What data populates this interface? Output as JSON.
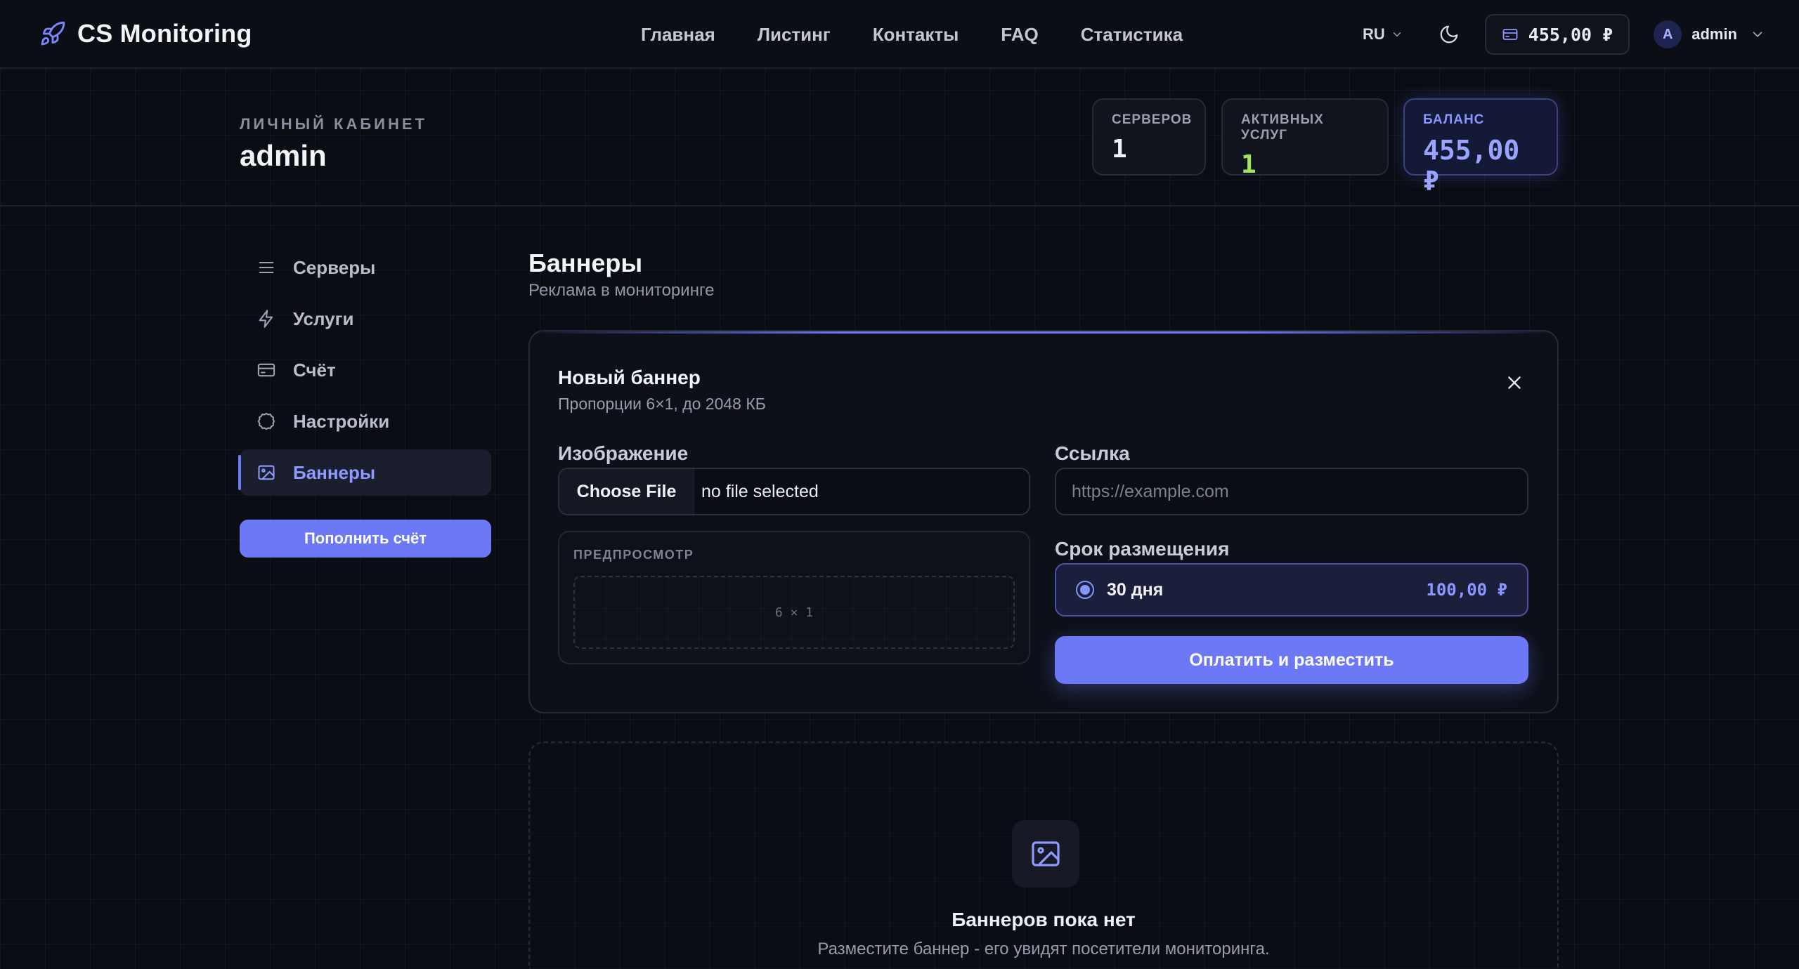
{
  "brand": {
    "name": "CS Monitoring",
    "icon": "rocket-icon"
  },
  "nav": {
    "links": [
      "Главная",
      "Листинг",
      "Контакты",
      "FAQ",
      "Статистика"
    ],
    "language": "RU",
    "balance": "455,00 ₽",
    "user": {
      "avatar_letter": "A",
      "name": "admin"
    }
  },
  "header": {
    "label": "ЛИЧНЫЙ КАБИНЕТ",
    "username": "admin",
    "stats": {
      "servers": {
        "label": "СЕРВЕРОВ",
        "value": "1"
      },
      "services": {
        "label": "АКТИВНЫХ УСЛУГ",
        "value": "1"
      },
      "balance": {
        "label": "БАЛАНС",
        "value": "455,00 ₽"
      }
    }
  },
  "sidebar": {
    "items": [
      {
        "label": "Серверы",
        "icon": "list-icon"
      },
      {
        "label": "Услуги",
        "icon": "bolt-icon"
      },
      {
        "label": "Счёт",
        "icon": "card-icon"
      },
      {
        "label": "Настройки",
        "icon": "gear-icon"
      },
      {
        "label": "Баннеры",
        "icon": "image-icon",
        "active": true
      }
    ],
    "topup_label": "Пополнить счёт"
  },
  "page": {
    "title": "Баннеры",
    "subtitle": "Реклама в мониторинге"
  },
  "form": {
    "title": "Новый баннер",
    "subtitle": "Пропорции 6×1, до 2048 КБ",
    "image_label": "Изображение",
    "file_button": "Choose File",
    "file_status": "no file selected",
    "preview_label": "ПРЕДПРОСМОТР",
    "preview_ratio": "6 × 1",
    "link_label": "Ссылка",
    "link_placeholder": "https://example.com",
    "link_value": "",
    "term_label": "Срок размещения",
    "term_option": {
      "label": "30 дня",
      "price": "100,00 ₽",
      "selected": true
    },
    "pay_button": "Оплатить и разместить"
  },
  "empty": {
    "title": "Баннеров пока нет",
    "text": "Разместите баннер - его увидят посетители мониторинга."
  },
  "colors": {
    "accent": "#6c78f5",
    "accent_text": "#8c96ff",
    "success": "#a5e35a",
    "background": "#0b0d14"
  }
}
